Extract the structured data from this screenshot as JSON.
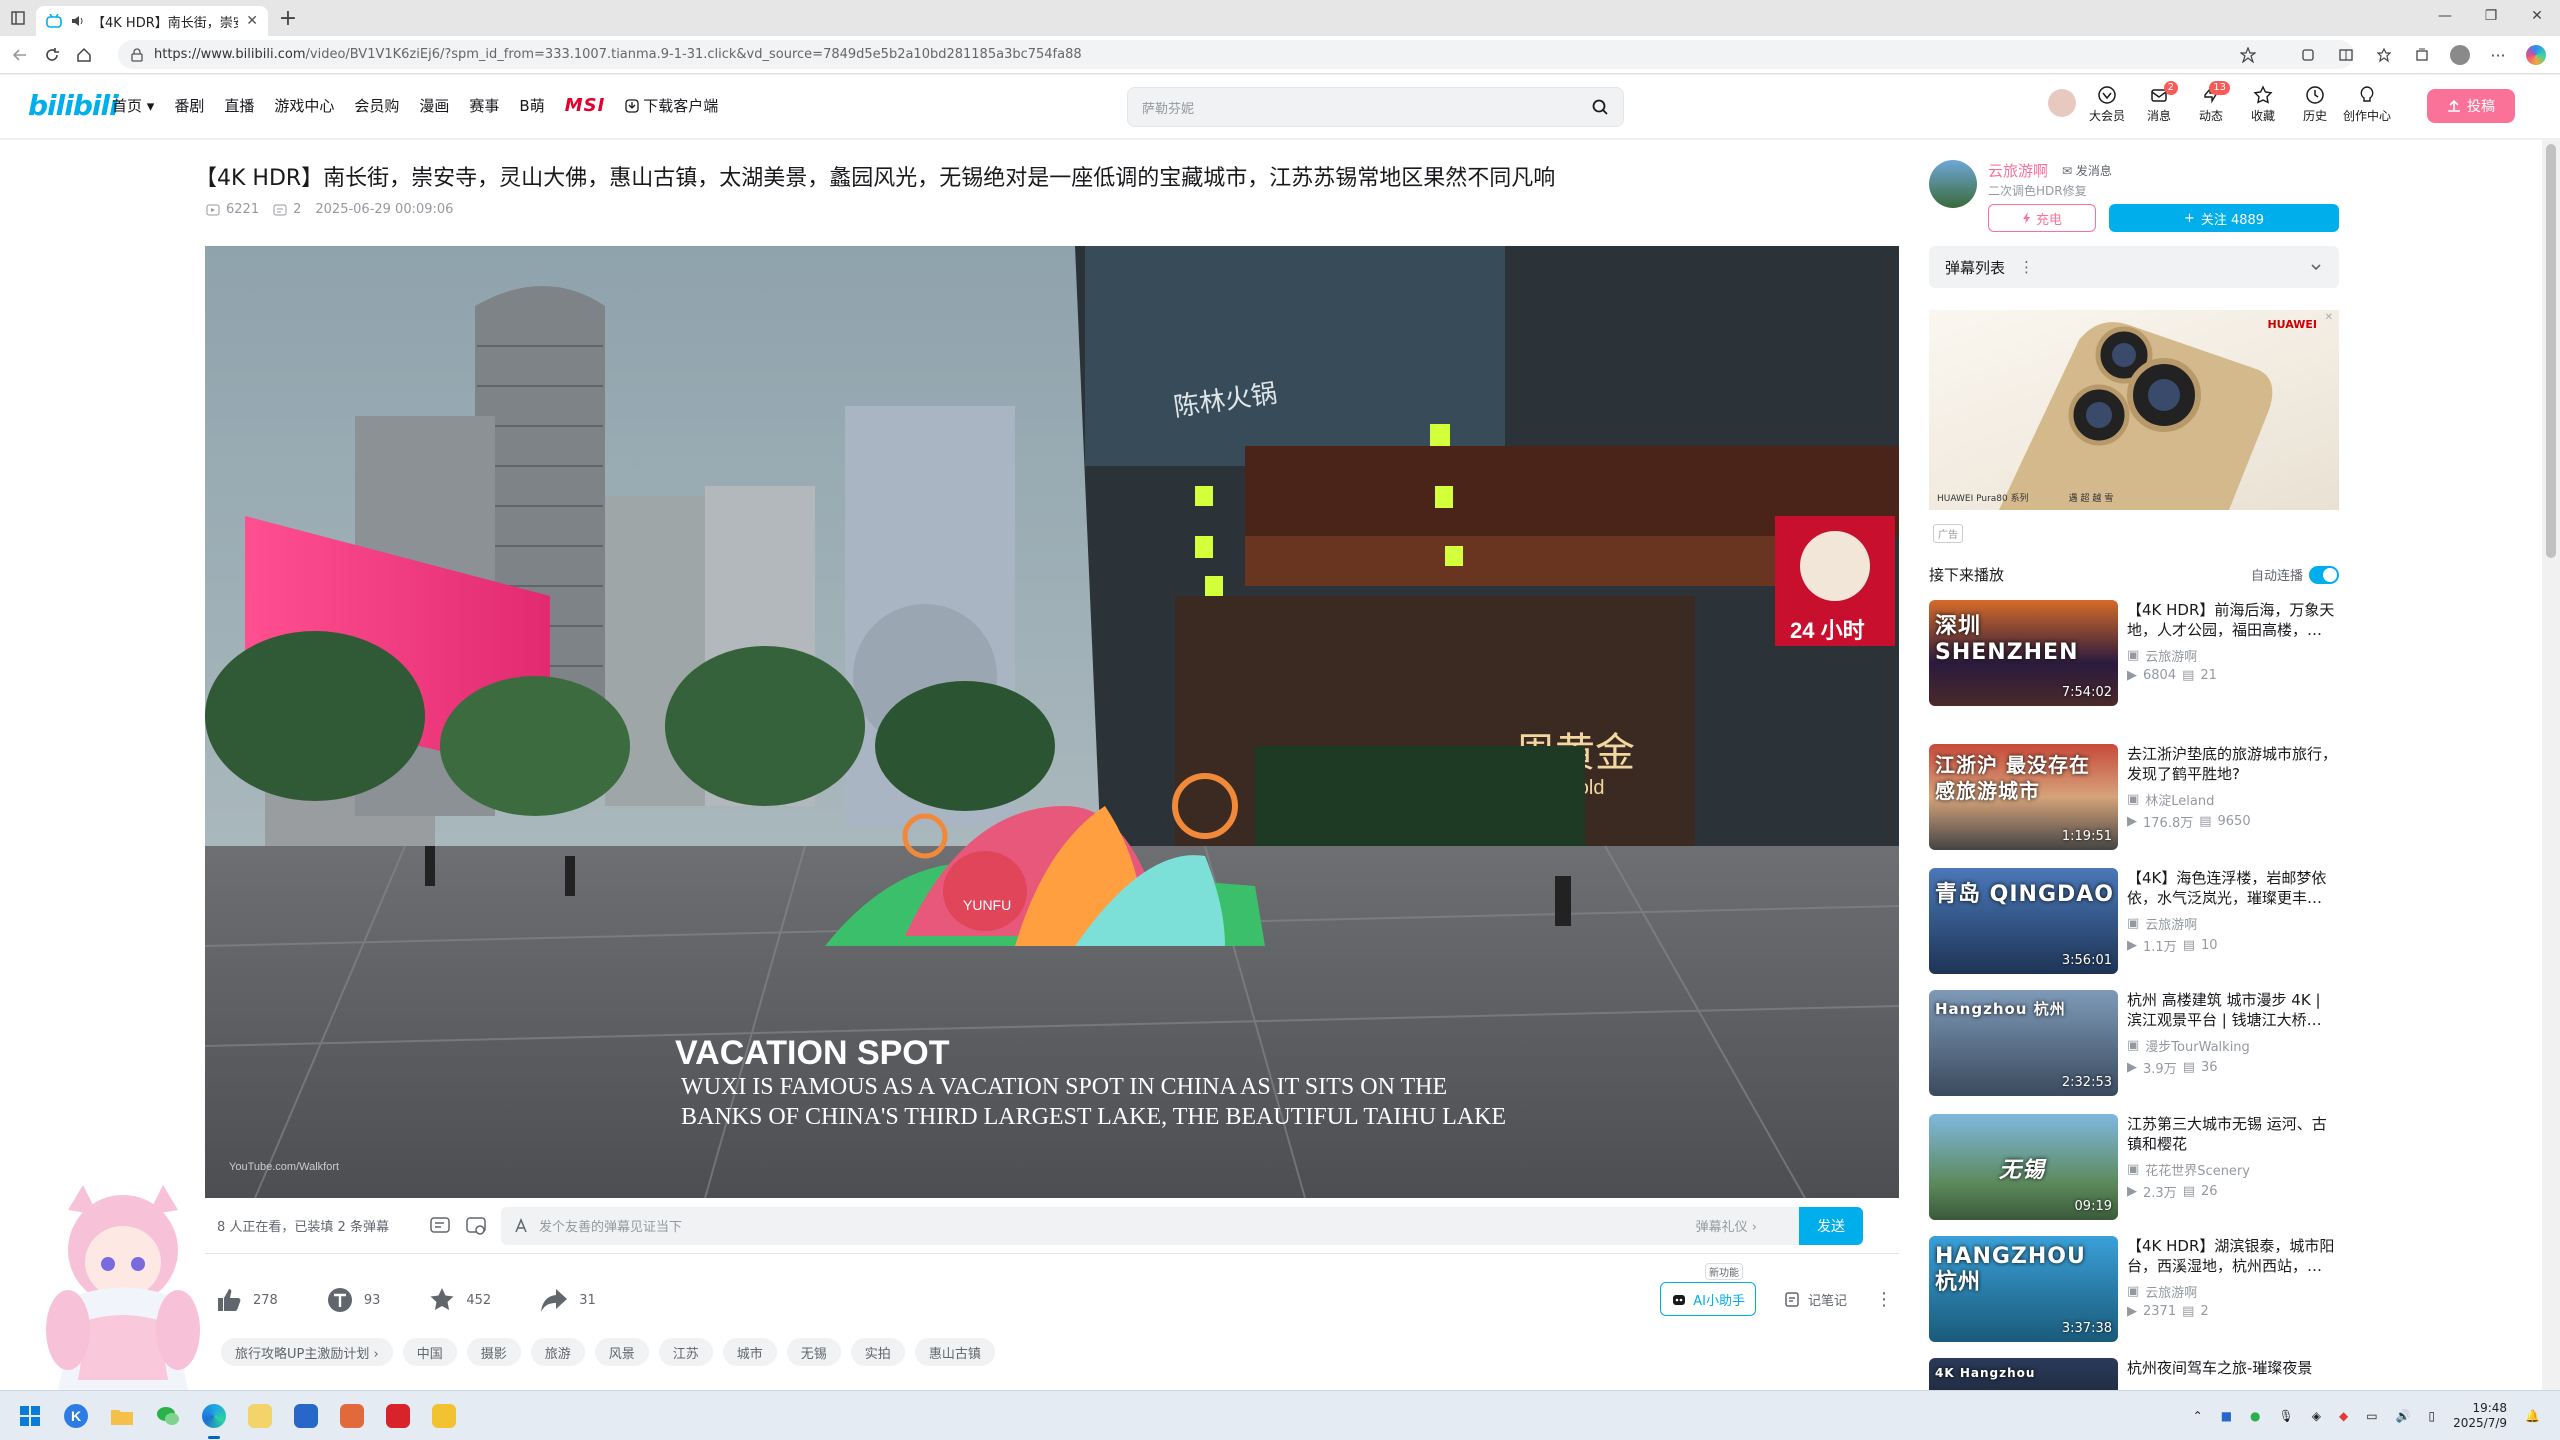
{
  "browser": {
    "tab_title": "【4K HDR】南长街，崇安寺",
    "url_domain": "https://www.bilibili.com",
    "url_path": "/video/BV1V1K6ziEj6/?spm_id_from=333.1007.tianma.9-1-31.click&vd_source=7849d5e5b2a10bd281185a3bc754fa88"
  },
  "header": {
    "logo": "bilibili",
    "nav": [
      "首页",
      "番剧",
      "直播",
      "游戏中心",
      "会员购",
      "漫画",
      "赛事",
      "B萌",
      "MSI",
      "下载客户端"
    ],
    "search_placeholder": "萨勒芬妮",
    "right": [
      {
        "label": "大会员",
        "icon": "vip-icon",
        "badge": ""
      },
      {
        "label": "消息",
        "icon": "message-icon",
        "badge": "2"
      },
      {
        "label": "动态",
        "icon": "dynamic-icon",
        "badge": "13"
      },
      {
        "label": "收藏",
        "icon": "star-icon",
        "badge": ""
      },
      {
        "label": "历史",
        "icon": "history-icon",
        "badge": ""
      },
      {
        "label": "创作中心",
        "icon": "bulb-icon",
        "badge": ""
      }
    ],
    "upload_label": "投稿"
  },
  "video": {
    "title": "【4K HDR】南长街，崇安寺，灵山大佛，惠山古镇，太湖美景，蠡园风光，无锡绝对是一座低调的宝藏城市，江苏苏锡常地区果然不同凡响",
    "views": "6221",
    "danmaku": "2",
    "date": "2025-06-29 00:09:06",
    "frame_sign_store": "陈林火锅",
    "frame_sign_gold": "周黄金",
    "frame_sign_gold_sub": "ina Gold",
    "frame_sign_kfc": "24 小时",
    "frame_subtitle_title": "VACATION SPOT",
    "frame_subtitle_line1": "WUXI IS FAMOUS AS A VACATION SPOT IN CHINA AS IT SITS ON THE",
    "frame_subtitle_line2": "BANKS OF CHINA'S THIRD LARGEST LAKE, THE BEAUTIFUL TAIHU LAKE",
    "frame_watermark": "YouTube.com/Walkfort",
    "frame_yunfu": "YUNFU"
  },
  "danmaku_bar": {
    "watching": "8 人正在看，已装填 2 条弹幕",
    "placeholder": "发个友善的弹幕见证当下",
    "etiquette": "弹幕礼仪 ›",
    "send": "发送"
  },
  "actions": {
    "like": "278",
    "coin": "93",
    "fav": "452",
    "share": "31",
    "ai_label": "AI小助手",
    "ai_new": "新功能",
    "note_label": "记笔记"
  },
  "tags": [
    "旅行攻略UP主激励计划 ›",
    "中国",
    "摄影",
    "旅游",
    "风景",
    "江苏",
    "城市",
    "无锡",
    "实拍",
    "惠山古镇"
  ],
  "uploader": {
    "name": "云旅游啊",
    "msg": "发消息",
    "desc": "二次调色HDR修复",
    "charge": "充电",
    "follow": "关注 4889"
  },
  "danmaku_list_label": "弹幕列表",
  "ad": {
    "brand": "HUAWEI",
    "caption_a": "HUAWEI Pura80 系列",
    "caption_b": "遇 超 越 雪",
    "tag": "广告"
  },
  "next": {
    "label": "接下来播放",
    "autoplay": "自动连播"
  },
  "recommendations": [
    {
      "title": "【4K HDR】前海后海，万象天地，人才公园，福田高楼，…",
      "author": "云旅游啊",
      "views": "6804",
      "dm": "21",
      "duration": "7:54:02",
      "overlay": "深圳 SHENZHEN"
    },
    {
      "title": "去江浙沪垫底的旅游城市旅行，发现了鹤平胜地?",
      "author": "林淀Leland",
      "views": "176.8万",
      "dm": "9650",
      "duration": "1:19:51",
      "overlay": "江浙沪 最没存在感旅游城市"
    },
    {
      "title": "【4K】海色连浮楼，岩邮梦依依，水气泛岚光，璀璨更丰…",
      "author": "云旅游啊",
      "views": "1.1万",
      "dm": "10",
      "duration": "3:56:01",
      "overlay": "青岛 QINGDAO"
    },
    {
      "title": "杭州 高楼建筑 城市漫步 4K | 滨江观景平台 | 钱塘江大桥…",
      "author": "漫步TourWalking",
      "views": "3.9万",
      "dm": "36",
      "duration": "2:32:53",
      "overlay": "Hangzhou 杭州"
    },
    {
      "title": "江苏第三大城市无锡 运河、古镇和樱花",
      "author": "花花世界Scenery",
      "views": "2.3万",
      "dm": "26",
      "duration": "09:19",
      "overlay": "无锡"
    },
    {
      "title": "【4K HDR】湖滨银泰，城市阳台，西溪湿地，杭州西站，…",
      "author": "云旅游啊",
      "views": "2371",
      "dm": "2",
      "duration": "3:37:38",
      "overlay": "HANGZHOU 杭州"
    },
    {
      "title": "杭州夜间驾车之旅-璀璨夜景",
      "author": "",
      "views": "",
      "dm": "",
      "duration": "",
      "overlay": "4K Hangzhou"
    }
  ],
  "taskbar": {
    "time": "19:48",
    "date": "2025/7/9"
  }
}
